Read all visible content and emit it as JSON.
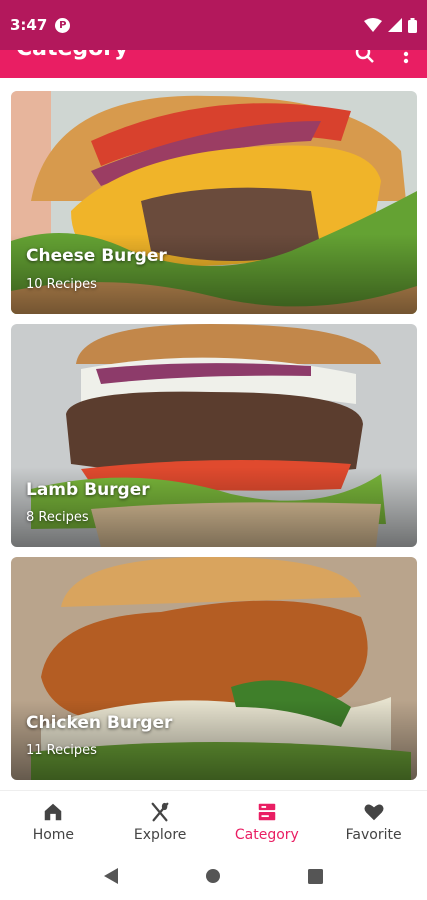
{
  "status": {
    "time": "3:47",
    "app_indicator": "P"
  },
  "app_bar": {
    "title": "Category",
    "actions": [
      "search-icon",
      "more-vert-icon"
    ]
  },
  "categories": [
    {
      "name": "Cheese Burger",
      "count": "10 Recipes"
    },
    {
      "name": "Lamb Burger",
      "count": "8 Recipes"
    },
    {
      "name": "Chicken Burger",
      "count": "11 Recipes"
    }
  ],
  "bottom_nav": {
    "items": [
      {
        "label": "Home",
        "icon": "home-icon"
      },
      {
        "label": "Explore",
        "icon": "fork-knife-icon"
      },
      {
        "label": "Category",
        "icon": "category-icon"
      },
      {
        "label": "Favorite",
        "icon": "heart-icon"
      }
    ],
    "active": "Category"
  },
  "colors": {
    "status_bar": "#b3185c",
    "primary": "#e91e63",
    "nav_inactive": "#444444"
  }
}
